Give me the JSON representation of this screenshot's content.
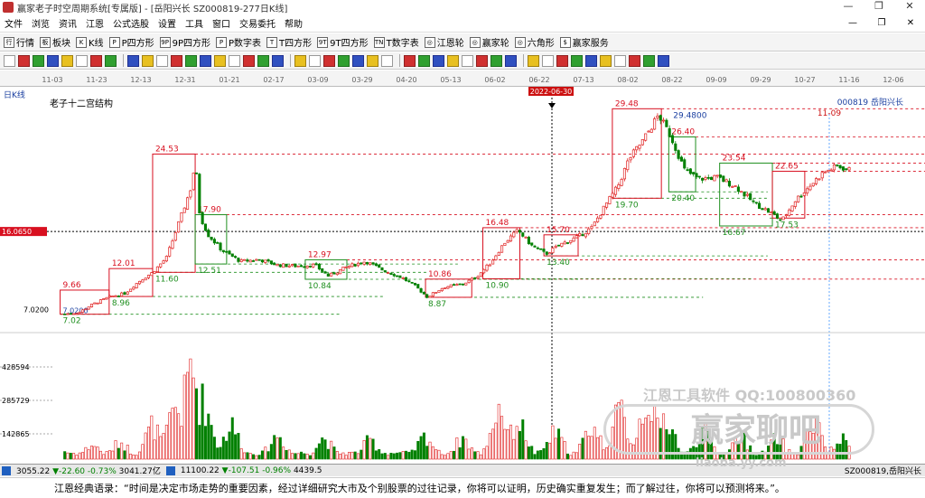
{
  "titlebar": {
    "title": "赢家老子时空周期系统[专属版] - [岳阳兴长  SZ000819-277日K线]",
    "min": "—",
    "max": "❐",
    "close": "✕"
  },
  "menu": {
    "items": [
      "文件",
      "浏览",
      "资讯",
      "江恩",
      "公式选股",
      "设置",
      "工具",
      "窗口",
      "交易委托",
      "帮助"
    ],
    "right": [
      "—",
      "❐",
      "✕"
    ]
  },
  "toolbar1": {
    "items": [
      {
        "icon": "行",
        "label": "行情"
      },
      {
        "icon": "板",
        "label": "板块"
      },
      {
        "icon": "K",
        "label": "K线"
      },
      {
        "icon": "P",
        "label": "P四方形"
      },
      {
        "icon": "9P",
        "label": "9P四方形"
      },
      {
        "icon": "P",
        "label": "P数字表"
      },
      {
        "icon": "T",
        "label": "T四方形"
      },
      {
        "icon": "9T",
        "label": "9T四方形"
      },
      {
        "icon": "TN",
        "label": "T数字表"
      },
      {
        "icon": "◎",
        "label": "江恩轮"
      },
      {
        "icon": "◎",
        "label": "赢家轮"
      },
      {
        "icon": "◎",
        "label": "六角形"
      },
      {
        "icon": "$",
        "label": "赢家服务"
      }
    ]
  },
  "toolbar2": {
    "count": 44
  },
  "chart_data": {
    "type": "candlestick",
    "period_label": "日K线",
    "indicator_title": "老子十二宫结构",
    "stock_code": "000819",
    "stock_name": "岳阳兴长",
    "cursor_date": "2022-06-30",
    "right_date_label": "11-09",
    "date_ticks": [
      "11-03",
      "11-23",
      "12-13",
      "12-31",
      "01-21",
      "02-17",
      "03-09",
      "03-29",
      "04-20",
      "05-13",
      "06-02",
      "06-22",
      "07-13",
      "08-02",
      "08-22",
      "09-09",
      "09-29",
      "10-27",
      "11-16",
      "12-06"
    ],
    "price_axis": {
      "min": 6.0,
      "max": 30.5,
      "cursor_value": "16.0650",
      "low_label": "7.0200"
    },
    "volume_axis": {
      "labels": [
        "428594",
        "285729",
        "142865"
      ],
      "max": 560000
    },
    "levels": [
      {
        "price": 24.53,
        "label": "24.53"
      },
      {
        "price": 17.9,
        "label": "17.90"
      },
      {
        "price": 12.97,
        "label": "12.97"
      },
      {
        "price": 10.86,
        "label": "10.86"
      },
      {
        "price": 16.48,
        "label": "16.48"
      },
      {
        "price": 29.48,
        "label": "29.48"
      },
      {
        "price": 26.4,
        "label": "26.40"
      },
      {
        "price": 23.54,
        "label": "23.54"
      },
      {
        "price": 22.65,
        "label": "22.65"
      }
    ],
    "boxes": [
      {
        "x1": 0.065,
        "x2": 0.118,
        "y1": 7.02,
        "y2": 9.66,
        "hi": "9.66",
        "lo": "7.02",
        "lo2": "7.0200",
        "c": "red"
      },
      {
        "x1": 0.118,
        "x2": 0.165,
        "y1": 8.96,
        "y2": 12.01,
        "hi": "12.01",
        "lo": "8.96",
        "c": "red"
      },
      {
        "x1": 0.165,
        "x2": 0.211,
        "y1": 11.6,
        "y2": 24.53,
        "hi": "24.53",
        "lo": "11.60",
        "c": "red"
      },
      {
        "x1": 0.211,
        "x2": 0.245,
        "y1": 12.51,
        "y2": 17.9,
        "hi": "17.90",
        "lo": "12.51",
        "c": "grn"
      },
      {
        "x1": 0.33,
        "x2": 0.375,
        "y1": 10.84,
        "y2": 12.97,
        "hi": "12.97",
        "lo": "10.84",
        "c": "grn"
      },
      {
        "x1": 0.46,
        "x2": 0.51,
        "y1": 8.87,
        "y2": 10.86,
        "hi": "10.86",
        "lo": "8.87",
        "c": "red"
      },
      {
        "x1": 0.522,
        "x2": 0.562,
        "y1": 10.9,
        "y2": 16.48,
        "hi": "16.48",
        "lo": "10.90",
        "c": "red"
      },
      {
        "x1": 0.588,
        "x2": 0.625,
        "y1": 13.4,
        "y2": 15.7,
        "hi": "15.70",
        "lo": "13.40",
        "c": "red"
      },
      {
        "x1": 0.662,
        "x2": 0.715,
        "y1": 19.7,
        "y2": 29.48,
        "hi": "29.48",
        "lo": "19.70",
        "c": "red"
      },
      {
        "x1": 0.723,
        "x2": 0.752,
        "y1": 20.4,
        "y2": 26.4,
        "hi": "26.40",
        "lo": "20.40",
        "c": "grn"
      },
      {
        "x1": 0.778,
        "x2": 0.835,
        "y1": 16.67,
        "y2": 23.54,
        "hi": "23.54",
        "lo": "16.67",
        "c": "grn"
      },
      {
        "x1": 0.835,
        "x2": 0.87,
        "y1": 17.53,
        "y2": 22.65,
        "hi": "22.65",
        "lo": "17.53",
        "c": "red"
      }
    ],
    "extra_labels": [
      {
        "x": 0.72,
        "y": 29.48,
        "text": "29.4800",
        "c": "blue"
      }
    ],
    "close_path": [
      [
        0.07,
        7.05
      ],
      [
        0.085,
        7.2
      ],
      [
        0.1,
        8.1
      ],
      [
        0.118,
        8.9
      ],
      [
        0.135,
        9.3
      ],
      [
        0.15,
        10.6
      ],
      [
        0.165,
        11.6
      ],
      [
        0.18,
        13.2
      ],
      [
        0.195,
        17.5
      ],
      [
        0.207,
        21.0
      ],
      [
        0.211,
        23.8
      ],
      [
        0.216,
        17.8
      ],
      [
        0.225,
        15.7
      ],
      [
        0.24,
        14.0
      ],
      [
        0.26,
        12.8
      ],
      [
        0.28,
        13.0
      ],
      [
        0.3,
        12.4
      ],
      [
        0.32,
        12.3
      ],
      [
        0.34,
        12.4
      ],
      [
        0.355,
        11.2
      ],
      [
        0.375,
        12.2
      ],
      [
        0.395,
        12.8
      ],
      [
        0.415,
        11.8
      ],
      [
        0.435,
        11.0
      ],
      [
        0.45,
        10.0
      ],
      [
        0.462,
        8.9
      ],
      [
        0.48,
        10.0
      ],
      [
        0.5,
        10.3
      ],
      [
        0.515,
        11.1
      ],
      [
        0.53,
        12.6
      ],
      [
        0.545,
        14.8
      ],
      [
        0.56,
        16.2
      ],
      [
        0.575,
        14.5
      ],
      [
        0.59,
        13.6
      ],
      [
        0.605,
        14.6
      ],
      [
        0.625,
        15.5
      ],
      [
        0.64,
        16.5
      ],
      [
        0.655,
        19.0
      ],
      [
        0.668,
        21.0
      ],
      [
        0.68,
        24.0
      ],
      [
        0.695,
        26.0
      ],
      [
        0.712,
        28.8
      ],
      [
        0.725,
        26.5
      ],
      [
        0.74,
        22.8
      ],
      [
        0.755,
        21.8
      ],
      [
        0.775,
        22.0
      ],
      [
        0.795,
        21.0
      ],
      [
        0.815,
        19.2
      ],
      [
        0.835,
        18.0
      ],
      [
        0.845,
        17.2
      ],
      [
        0.86,
        19.5
      ],
      [
        0.875,
        21.0
      ],
      [
        0.89,
        22.5
      ],
      [
        0.905,
        23.2
      ],
      [
        0.918,
        22.8
      ]
    ],
    "volume_peaks": [
      [
        0.07,
        0.08
      ],
      [
        0.1,
        0.15
      ],
      [
        0.13,
        0.18
      ],
      [
        0.165,
        0.35
      ],
      [
        0.19,
        0.55
      ],
      [
        0.207,
        0.98
      ],
      [
        0.22,
        0.6
      ],
      [
        0.25,
        0.35
      ],
      [
        0.3,
        0.25
      ],
      [
        0.35,
        0.22
      ],
      [
        0.4,
        0.2
      ],
      [
        0.46,
        0.24
      ],
      [
        0.5,
        0.22
      ],
      [
        0.54,
        0.55
      ],
      [
        0.56,
        0.4
      ],
      [
        0.6,
        0.28
      ],
      [
        0.64,
        0.35
      ],
      [
        0.67,
        0.5
      ],
      [
        0.7,
        0.65
      ],
      [
        0.72,
        0.45
      ],
      [
        0.76,
        0.3
      ],
      [
        0.8,
        0.25
      ],
      [
        0.84,
        0.22
      ],
      [
        0.88,
        0.38
      ],
      [
        0.91,
        0.2
      ]
    ]
  },
  "watermark": {
    "line1": "江恩工具软件  QQ:100800360",
    "line2": "赢家聊吧",
    "line3": "liaoba.yy.com"
  },
  "status": {
    "sh": "3055.22",
    "sh_chg": "▼-22.60",
    "sh_pct": "-0.73%",
    "sh_amt": "3041.27亿",
    "sz": "11100.22",
    "sz_chg": "▼-107.51",
    "sz_pct": "-0.96%",
    "sz_amt": "4439.5",
    "right": "SZ000819,岳阳兴长"
  },
  "footer": {
    "quote": "江恩经典语录：“时间是决定市场走势的重要因素，经过详细研究大市及个别股票的过往记录，你将可以证明，历史确实重复发生；而了解过往，你将可以预测将来。”。"
  },
  "colors": {
    "up": "#e02020",
    "down": "#008000",
    "level": "#d81020",
    "box_green": "#1f8f1f",
    "axis_blue": "#1a3fa0"
  }
}
